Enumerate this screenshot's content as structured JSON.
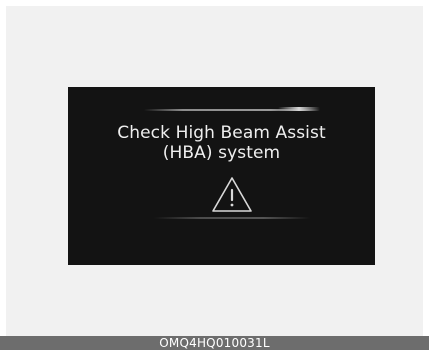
{
  "display": {
    "message_line1": "Check High Beam Assist",
    "message_line2": "(HBA) system",
    "icon": "warning-triangle-icon"
  },
  "caption": {
    "code": "OMQ4HQ010031L"
  },
  "colors": {
    "background": "#ffffff",
    "panel_background": "#f1f1f1",
    "display_background": "#131313",
    "text": "#efefef",
    "caption_bar": "#6d6d6d",
    "caption_text": "#ffffff"
  }
}
